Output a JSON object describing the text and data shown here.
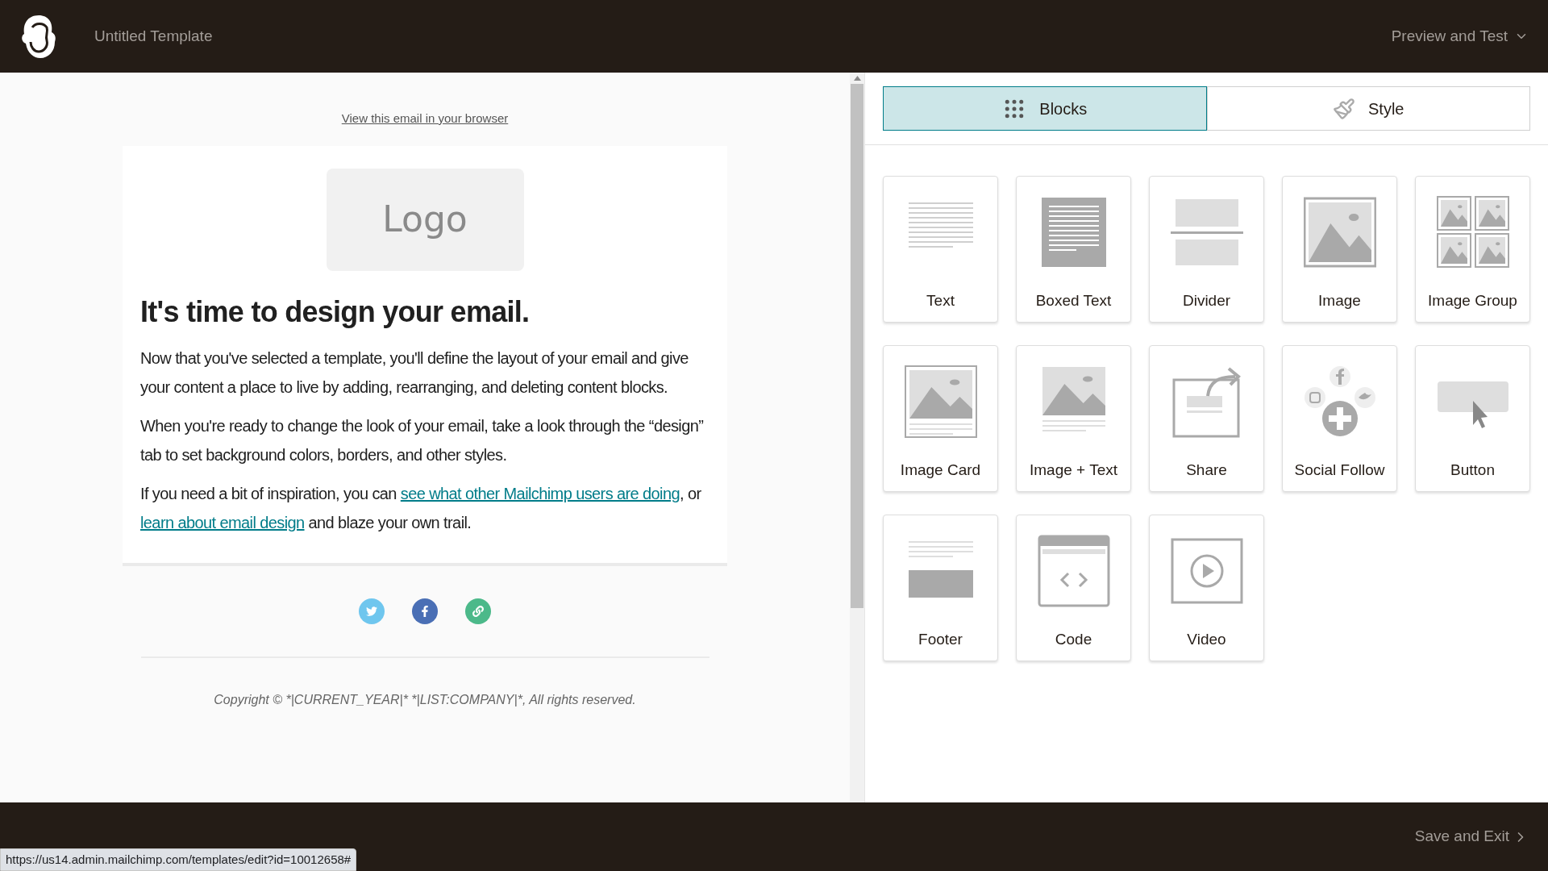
{
  "header": {
    "title": "Untitled Template",
    "menu": "Preview and Test"
  },
  "email": {
    "browser_link": "View this email in your browser",
    "logo_placeholder": "Logo",
    "heading": "It's time to design your email.",
    "paragraphs": [
      [
        {
          "text": "Now that you've selected a template, you'll define the layout of your email and give your content a place to live by adding, rearranging, and deleting content blocks."
        }
      ],
      [
        {
          "text": "When you're ready to change the look of your email, take a look through the “design” tab to set background colors, borders, and other styles."
        }
      ],
      [
        {
          "text": "If you need a bit of inspiration, you can "
        },
        {
          "text": "see what other Mailchimp users are doing",
          "link": true
        },
        {
          "text": ", or "
        },
        {
          "text": "learn about email design",
          "link": true
        },
        {
          "text": " and blaze your own trail."
        }
      ]
    ],
    "social_icons": [
      {
        "kind": "twitter",
        "color": "#6fc6ee"
      },
      {
        "kind": "facebook",
        "color": "#4a6fb5"
      },
      {
        "kind": "link",
        "color": "#4cb98a"
      }
    ],
    "copyright": "Copyright © *|CURRENT_YEAR|* *|LIST:COMPANY|*, All rights reserved."
  },
  "panel": {
    "tabs": [
      {
        "label": "Blocks",
        "kind": "grid",
        "selected": true
      },
      {
        "label": "Style",
        "kind": "brush",
        "selected": false
      }
    ],
    "blocks": [
      {
        "label": "Text",
        "kind": "text"
      },
      {
        "label": "Boxed Text",
        "kind": "boxed"
      },
      {
        "label": "Divider",
        "kind": "divider"
      },
      {
        "label": "Image",
        "kind": "image"
      },
      {
        "label": "Image Group",
        "kind": "imagegroup"
      },
      {
        "label": "Image Card",
        "kind": "imagecard"
      },
      {
        "label": "Image + Text",
        "kind": "imagetext"
      },
      {
        "label": "Share",
        "kind": "share"
      },
      {
        "label": "Social Follow",
        "kind": "social"
      },
      {
        "label": "Button",
        "kind": "button"
      },
      {
        "label": "Footer",
        "kind": "footer"
      },
      {
        "label": "Code",
        "kind": "code"
      },
      {
        "label": "Video",
        "kind": "video"
      }
    ]
  },
  "footer": {
    "save": "Save and Exit"
  },
  "status_url": "https://us14.admin.mailchimp.com/templates/edit?id=10012658#"
}
